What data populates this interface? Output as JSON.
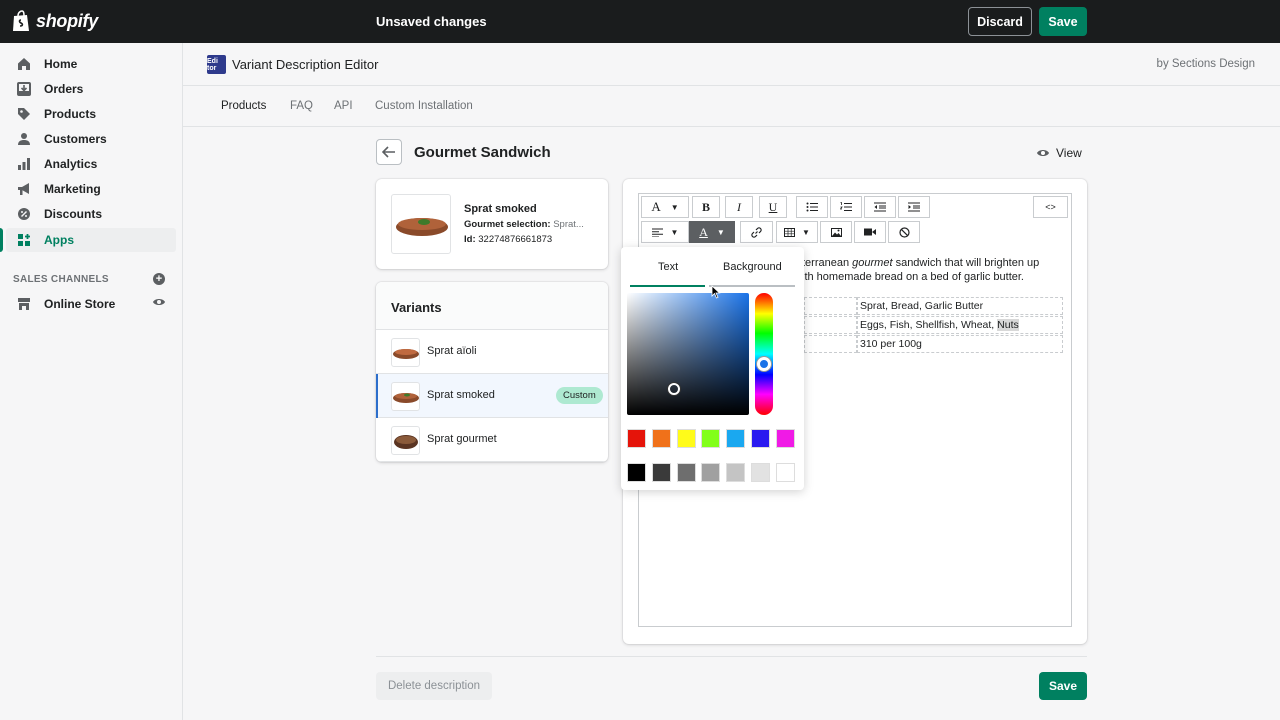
{
  "topbar": {
    "logo_text": "shopify",
    "status": "Unsaved changes",
    "discard_label": "Discard",
    "save_label": "Save"
  },
  "sidebar": {
    "items": [
      {
        "label": "Home",
        "icon": "home-icon"
      },
      {
        "label": "Orders",
        "icon": "orders-icon"
      },
      {
        "label": "Products",
        "icon": "tag-icon"
      },
      {
        "label": "Customers",
        "icon": "person-icon"
      },
      {
        "label": "Analytics",
        "icon": "bar-chart-icon"
      },
      {
        "label": "Marketing",
        "icon": "megaphone-icon"
      },
      {
        "label": "Discounts",
        "icon": "discount-icon"
      },
      {
        "label": "Apps",
        "icon": "apps-icon",
        "active": true
      }
    ],
    "sales_channels_label": "SALES CHANNELS",
    "online_store_label": "Online Store"
  },
  "app": {
    "icon_text": "Edi tor",
    "title": "Variant Description Editor",
    "by": "by Sections Design",
    "tabs": [
      "Products",
      "FAQ",
      "API",
      "Custom Installation"
    ]
  },
  "page": {
    "title": "Gourmet Sandwich",
    "view_label": "View"
  },
  "product": {
    "name": "Sprat smoked",
    "selection_label": "Gourmet selection:",
    "selection_value": "Sprat...",
    "id_label": "Id:",
    "id_value": "32274876661873"
  },
  "variants": {
    "header": "Variants",
    "items": [
      {
        "name": "Sprat aïoli",
        "selected": false
      },
      {
        "name": "Sprat smoked",
        "selected": true,
        "badge": "Custom"
      },
      {
        "name": "Sprat gourmet",
        "selected": false
      }
    ]
  },
  "editor": {
    "source_label": "<>",
    "text_line1_a": "terranean ",
    "text_line1_em": "gourmet",
    "text_line1_b": " sandwich that will brighten up",
    "text_line2": "ith homemade bread on a bed of garlic butter.",
    "table": [
      {
        "value": "Sprat, Bread, Garlic Butter"
      },
      {
        "value": "Eggs, Fish, Shellfish, Wheat, ",
        "highlight": "Nuts"
      },
      {
        "value": "310 per 100g"
      }
    ]
  },
  "picker": {
    "tab_text": "Text",
    "tab_background": "Background",
    "selected_hue": "#1a73e8",
    "swatches_row1": [
      "#e5140a",
      "#f0711a",
      "#fffb1a",
      "#82ff1a",
      "#1aa8f0",
      "#2a1af0",
      "#f01ae6"
    ],
    "swatches_row2": [
      "#000000",
      "#3a3a3a",
      "#6e6e6e",
      "#a0a0a0",
      "#c4c4c4",
      "#e2e2e2",
      "#ffffff"
    ]
  },
  "footer": {
    "delete_label": "Delete description",
    "save_label": "Save"
  },
  "colors": {
    "brand_green": "#008060",
    "topbar_bg": "#1a1c1d",
    "badge_bg": "#aee9d1"
  }
}
